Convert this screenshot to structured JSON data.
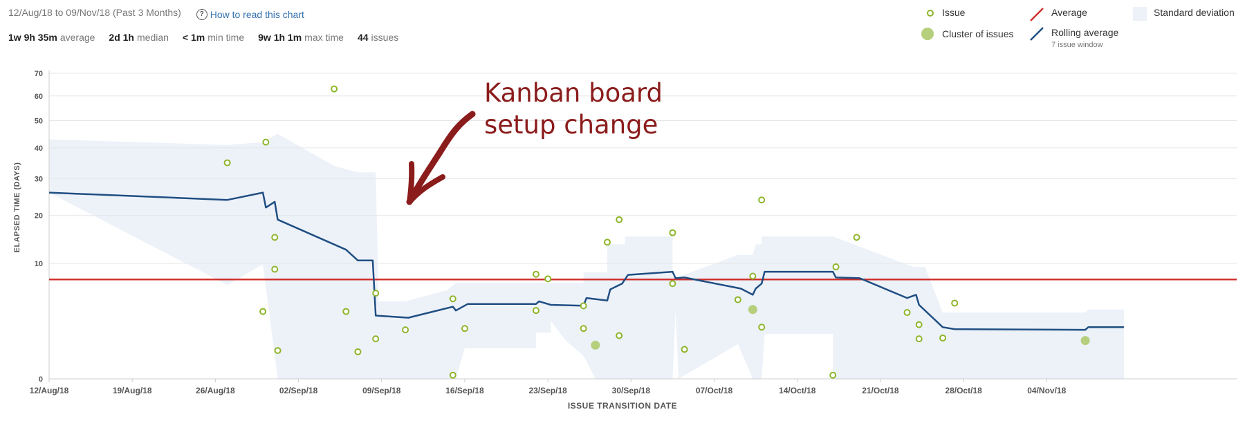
{
  "header": {
    "date_range": "12/Aug/18 to 09/Nov/18 (Past 3 Months)",
    "help_link": "How to read this chart"
  },
  "stats": [
    {
      "value": "1w 9h 35m",
      "label": "average"
    },
    {
      "value": "2d 1h",
      "label": "median"
    },
    {
      "value": "< 1m",
      "label": "min time"
    },
    {
      "value": "9w 1h 1m",
      "label": "max time"
    },
    {
      "value": "44",
      "label": "issues"
    }
  ],
  "legend": {
    "issue": "Issue",
    "cluster": "Cluster of issues",
    "average": "Average",
    "rolling": "Rolling average",
    "rolling_sub": "7 issue window",
    "stddev": "Standard deviation"
  },
  "annotation": {
    "line1": "Kanban board",
    "line2": "setup change"
  },
  "colors": {
    "issue": "#8db52a",
    "cluster": "#b5cf7c",
    "average": "#d0312d",
    "rolling": "#1f4e82",
    "stddev": "#edf2f9",
    "annotation": "#8b1c1c"
  },
  "chart_data": {
    "type": "scatter",
    "xlabel": "ISSUE TRANSITION DATE",
    "ylabel": "ELAPSED TIME (DAYS)",
    "x_range": [
      "2018-08-12",
      "2018-11-20"
    ],
    "y_scale": "sqrt",
    "y_range": [
      0,
      70
    ],
    "y_ticks": [
      0,
      10,
      20,
      30,
      40,
      50,
      60,
      70
    ],
    "x_ticks": [
      "12/Aug/18",
      "19/Aug/18",
      "26/Aug/18",
      "02/Sep/18",
      "09/Sep/18",
      "16/Sep/18",
      "23/Sep/18",
      "30/Sep/18",
      "07/Oct/18",
      "14/Oct/18",
      "21/Oct/18",
      "28/Oct/18",
      "04/Nov/18"
    ],
    "average": 7.4,
    "issues": [
      {
        "x": "2018-08-27 00:00",
        "y": 35
      },
      {
        "x": "2018-08-30 00:00",
        "y": 3.4
      },
      {
        "x": "2018-08-30 06:00",
        "y": 42
      },
      {
        "x": "2018-08-31 00:00",
        "y": 15
      },
      {
        "x": "2018-08-31 00:00",
        "y": 9
      },
      {
        "x": "2018-08-31 06:00",
        "y": 0.6
      },
      {
        "x": "2018-09-05 00:00",
        "y": 63
      },
      {
        "x": "2018-09-06 00:00",
        "y": 3.4
      },
      {
        "x": "2018-09-07 00:00",
        "y": 0.55
      },
      {
        "x": "2018-09-08 12:00",
        "y": 5.5
      },
      {
        "x": "2018-09-08 12:00",
        "y": 1.2
      },
      {
        "x": "2018-09-11 00:00",
        "y": 1.8
      },
      {
        "x": "2018-09-15 00:00",
        "y": 0.01
      },
      {
        "x": "2018-09-15 00:00",
        "y": 4.8
      },
      {
        "x": "2018-09-16 00:00",
        "y": 1.9
      },
      {
        "x": "2018-09-22 00:00",
        "y": 8.2
      },
      {
        "x": "2018-09-22 00:00",
        "y": 3.5
      },
      {
        "x": "2018-09-23 00:00",
        "y": 7.5
      },
      {
        "x": "2018-09-26 00:00",
        "y": 4.0
      },
      {
        "x": "2018-09-26 00:00",
        "y": 1.9
      },
      {
        "x": "2018-09-28 00:00",
        "y": 14
      },
      {
        "x": "2018-09-29 00:00",
        "y": 19
      },
      {
        "x": "2018-09-29 00:00",
        "y": 1.4
      },
      {
        "x": "2018-10-03 12:00",
        "y": 16
      },
      {
        "x": "2018-10-03 12:00",
        "y": 6.8
      },
      {
        "x": "2018-10-04 12:00",
        "y": 0.65
      },
      {
        "x": "2018-10-09 00:00",
        "y": 4.7
      },
      {
        "x": "2018-10-10 06:00",
        "y": 7.9
      },
      {
        "x": "2018-10-11 00:00",
        "y": 24
      },
      {
        "x": "2018-10-11 00:00",
        "y": 2.0
      },
      {
        "x": "2018-10-17 00:00",
        "y": 0.01
      },
      {
        "x": "2018-10-17 06:00",
        "y": 9.4
      },
      {
        "x": "2018-10-19 00:00",
        "y": 15
      },
      {
        "x": "2018-10-23 06:00",
        "y": 3.3
      },
      {
        "x": "2018-10-24 06:00",
        "y": 2.2
      },
      {
        "x": "2018-10-24 06:00",
        "y": 1.2
      },
      {
        "x": "2018-10-26 06:00",
        "y": 1.25
      },
      {
        "x": "2018-10-27 06:00",
        "y": 4.3
      }
    ],
    "clusters": [
      {
        "x": "2018-09-27 00:00",
        "y": 0.85
      },
      {
        "x": "2018-10-10 06:00",
        "y": 3.6
      },
      {
        "x": "2018-11-07 06:00",
        "y": 1.1
      }
    ],
    "rolling_average": [
      {
        "x": "2018-08-12 00:00",
        "y": 26
      },
      {
        "x": "2018-08-27 00:00",
        "y": 24
      },
      {
        "x": "2018-08-30 00:00",
        "y": 26
      },
      {
        "x": "2018-08-30 06:00",
        "y": 22
      },
      {
        "x": "2018-08-31 00:00",
        "y": 23.5
      },
      {
        "x": "2018-08-31 06:00",
        "y": 19
      },
      {
        "x": "2018-09-06 00:00",
        "y": 12.5
      },
      {
        "x": "2018-09-07 00:00",
        "y": 10.5
      },
      {
        "x": "2018-09-08 06:00",
        "y": 10.5
      },
      {
        "x": "2018-09-08 12:00",
        "y": 3.0
      },
      {
        "x": "2018-09-11 06:00",
        "y": 2.8
      },
      {
        "x": "2018-09-15 00:00",
        "y": 3.9
      },
      {
        "x": "2018-09-15 06:00",
        "y": 3.5
      },
      {
        "x": "2018-09-16 06:00",
        "y": 4.2
      },
      {
        "x": "2018-09-22 00:00",
        "y": 4.2
      },
      {
        "x": "2018-09-22 06:00",
        "y": 4.5
      },
      {
        "x": "2018-09-23 06:00",
        "y": 4.1
      },
      {
        "x": "2018-09-26 00:00",
        "y": 4.0
      },
      {
        "x": "2018-09-26 06:00",
        "y": 4.9
      },
      {
        "x": "2018-09-28 00:00",
        "y": 4.6
      },
      {
        "x": "2018-09-28 06:00",
        "y": 6.0
      },
      {
        "x": "2018-09-29 06:00",
        "y": 6.8
      },
      {
        "x": "2018-09-29 18:00",
        "y": 8.1
      },
      {
        "x": "2018-10-03 12:00",
        "y": 8.6
      },
      {
        "x": "2018-10-03 18:00",
        "y": 7.6
      },
      {
        "x": "2018-10-04 12:00",
        "y": 7.7
      },
      {
        "x": "2018-10-09 06:00",
        "y": 6.1
      },
      {
        "x": "2018-10-10 06:00",
        "y": 5.3
      },
      {
        "x": "2018-10-10 12:00",
        "y": 6.1
      },
      {
        "x": "2018-10-11 00:00",
        "y": 6.8
      },
      {
        "x": "2018-10-11 06:00",
        "y": 8.6
      },
      {
        "x": "2018-10-17 00:00",
        "y": 8.6
      },
      {
        "x": "2018-10-17 06:00",
        "y": 7.7
      },
      {
        "x": "2018-10-19 06:00",
        "y": 7.6
      },
      {
        "x": "2018-10-23 06:00",
        "y": 4.9
      },
      {
        "x": "2018-10-24 00:00",
        "y": 5.3
      },
      {
        "x": "2018-10-24 06:00",
        "y": 4.1
      },
      {
        "x": "2018-10-26 06:00",
        "y": 2.0
      },
      {
        "x": "2018-10-27 06:00",
        "y": 1.85
      },
      {
        "x": "2018-11-07 06:00",
        "y": 1.8
      },
      {
        "x": "2018-11-07 12:00",
        "y": 2.0
      },
      {
        "x": "2018-11-10 12:00",
        "y": 2.0
      }
    ],
    "std_dev_band": [
      {
        "x": "2018-08-12 00:00",
        "upper": 43,
        "lower": 26
      },
      {
        "x": "2018-08-27 00:00",
        "upper": 41,
        "lower": 6.6
      },
      {
        "x": "2018-08-30 00:00",
        "upper": 42,
        "lower": 9.8
      },
      {
        "x": "2018-08-31 06:00",
        "upper": 45,
        "lower": 0
      },
      {
        "x": "2018-09-05 00:00",
        "upper": 34,
        "lower": 0
      },
      {
        "x": "2018-09-07 00:00",
        "upper": 32,
        "lower": 0
      },
      {
        "x": "2018-09-08 12:00",
        "upper": 32,
        "lower": 0
      },
      {
        "x": "2018-09-08 18:00",
        "upper": 4.5,
        "lower": 0
      },
      {
        "x": "2018-09-11 00:00",
        "upper": 4.5,
        "lower": 0
      },
      {
        "x": "2018-09-14 12:00",
        "upper": 5.9,
        "lower": 0
      },
      {
        "x": "2018-09-15 06:00",
        "upper": 6.9,
        "lower": 0
      },
      {
        "x": "2018-09-16 00:00",
        "upper": 6.9,
        "lower": 0.7
      },
      {
        "x": "2018-09-22 00:00",
        "upper": 6.9,
        "lower": 0.7
      },
      {
        "x": "2018-09-22 00:00",
        "upper": 6.9,
        "lower": 1.6
      },
      {
        "x": "2018-09-23 06:00",
        "upper": 6.9,
        "lower": 1.6
      },
      {
        "x": "2018-09-23 06:00",
        "upper": 6.9,
        "lower": 2.5
      },
      {
        "x": "2018-09-24 12:00",
        "upper": 6.9,
        "lower": 1.1
      },
      {
        "x": "2018-09-26 00:00",
        "upper": 6.9,
        "lower": 0.4
      },
      {
        "x": "2018-09-26 00:00",
        "upper": 8.5,
        "lower": 0.4
      },
      {
        "x": "2018-09-27 00:00",
        "upper": 8.5,
        "lower": 0
      },
      {
        "x": "2018-09-28 00:00",
        "upper": 8.5,
        "lower": 0
      },
      {
        "x": "2018-09-28 00:00",
        "upper": 13.6,
        "lower": 0
      },
      {
        "x": "2018-09-29 12:00",
        "upper": 13.6,
        "lower": 0
      },
      {
        "x": "2018-09-29 12:00",
        "upper": 15.2,
        "lower": 0
      },
      {
        "x": "2018-10-03 12:00",
        "upper": 15.2,
        "lower": 0
      },
      {
        "x": "2018-10-03 12:00",
        "upper": 7.8,
        "lower": 0
      },
      {
        "x": "2018-10-03 18:00",
        "upper": 7.8,
        "lower": 3.5
      },
      {
        "x": "2018-10-04 00:00",
        "upper": 7.8,
        "lower": 0
      },
      {
        "x": "2018-10-09 00:00",
        "upper": 11.5,
        "lower": 0.9
      },
      {
        "x": "2018-10-10 06:00",
        "upper": 11.5,
        "lower": 0
      },
      {
        "x": "2018-10-10 12:00",
        "upper": 13.6,
        "lower": 0
      },
      {
        "x": "2018-10-11 00:00",
        "upper": 13.6,
        "lower": 0
      },
      {
        "x": "2018-10-11 00:00",
        "upper": 15.2,
        "lower": 0
      },
      {
        "x": "2018-10-11 06:00",
        "upper": 15.2,
        "lower": 1.5
      },
      {
        "x": "2018-10-17 00:00",
        "upper": 15.2,
        "lower": 1.5
      },
      {
        "x": "2018-10-17 00:00",
        "upper": 15.2,
        "lower": 0
      },
      {
        "x": "2018-10-23 18:00",
        "upper": 9.4,
        "lower": 0
      },
      {
        "x": "2018-10-24 18:00",
        "upper": 9.4,
        "lower": 0
      },
      {
        "x": "2018-10-26 06:00",
        "upper": 3.3,
        "lower": 0
      },
      {
        "x": "2018-11-07 06:00",
        "upper": 3.3,
        "lower": 0
      },
      {
        "x": "2018-11-07 12:00",
        "upper": 3.6,
        "lower": 0
      },
      {
        "x": "2018-11-10 12:00",
        "upper": 3.6,
        "lower": 0
      }
    ]
  }
}
